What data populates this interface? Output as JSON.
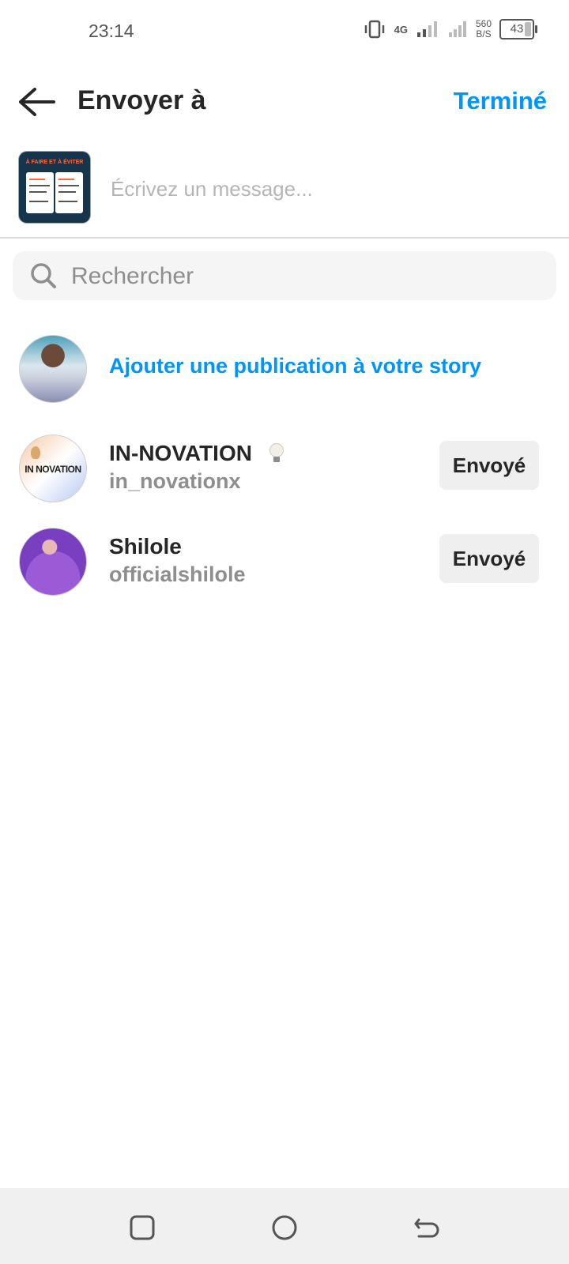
{
  "status_bar": {
    "time": "23:14",
    "network_label": "4G",
    "speed_value": "560",
    "speed_unit": "B/S",
    "battery": "43"
  },
  "header": {
    "title": "Envoyer à",
    "done_label": "Terminé"
  },
  "compose": {
    "message_placeholder": "Écrivez un message...",
    "thumb_title": "À FAIRE ET À ÉVITER"
  },
  "search": {
    "placeholder": "Rechercher"
  },
  "story": {
    "label": "Ajouter une publication à votre story"
  },
  "contacts": [
    {
      "name": "IN-NOVATION",
      "handle": "in_novationx",
      "avatar_text": "IN NOVATION",
      "status": "Envoyé"
    },
    {
      "name": "Shilole",
      "handle": "officialshilole",
      "status": "Envoyé"
    }
  ],
  "colors": {
    "accent": "#0095f6",
    "secondary_text": "#8e8e8e",
    "button_bg": "#efefef"
  }
}
